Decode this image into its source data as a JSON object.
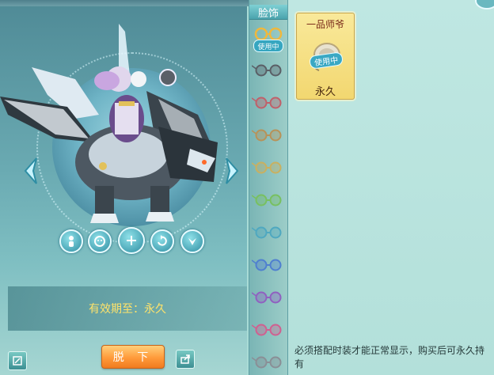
{
  "tabs": {
    "face_label": "脸饰"
  },
  "preview": {
    "validity_text": "有效期至：永久",
    "unequip_label": "脱 下",
    "action_icons": [
      "person-icon",
      "emote-icon",
      "plus-icon",
      "rotate-icon",
      "wings-icon"
    ]
  },
  "list": {
    "active_badge": "使用中",
    "glasses_colors": [
      "#5a5f66",
      "#c0606a",
      "#b89258",
      "#c9b060",
      "#78c060",
      "#4fa8c0",
      "#4f7fd0",
      "#9060c0",
      "#d06090",
      "#8a8f96"
    ]
  },
  "item": {
    "name": "一品师爷",
    "badge": "使用中",
    "duration": "永久"
  },
  "note": "必须搭配时装才能正常显示，购买后可永久持有",
  "colors": {
    "accent": "#ff9a3a",
    "validity": "#ffe36a",
    "card": "#f2d770"
  }
}
